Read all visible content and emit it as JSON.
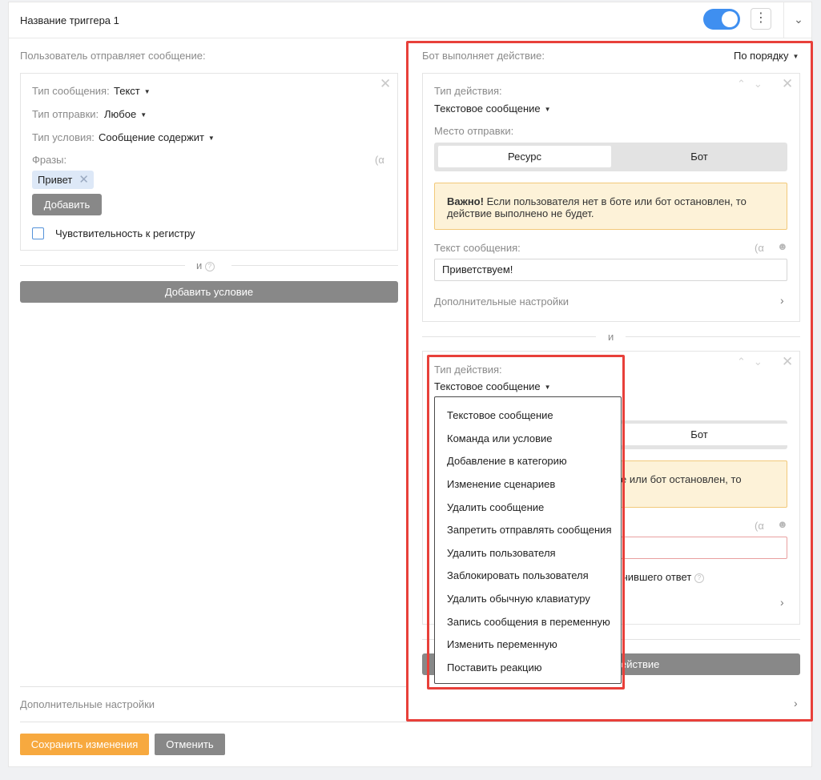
{
  "header": {
    "title": "Название триггера 1",
    "toggle_on": true
  },
  "left": {
    "section_title": "Пользователь отправляет сообщение:",
    "message_type_label": "Тип сообщения:",
    "message_type_value": "Текст",
    "send_type_label": "Тип отправки:",
    "send_type_value": "Любое",
    "condition_type_label": "Тип условия:",
    "condition_type_value": "Сообщение содержит",
    "phrases_label": "Фразы:",
    "phrase_tag": "Привет",
    "add_button": "Добавить",
    "case_sensitive_label": "Чувствительность к регистру",
    "and_label": "и",
    "add_condition_button": "Добавить условие"
  },
  "right": {
    "section_title": "Бот выполняет действие:",
    "order_select": "По порядку",
    "action1": {
      "action_type_label": "Тип действия:",
      "action_type_value": "Текстовое сообщение",
      "send_place_label": "Место отправки:",
      "seg_resource": "Ресурс",
      "seg_bot": "Бот",
      "warning_bold": "Важно!",
      "warning_text": " Если пользователя нет в боте или бот остановлен, то действие выполнено не будет.",
      "message_text_label": "Текст сообщения:",
      "message_text_value": "Приветствуем!",
      "extra_settings": "Дополнительные настройки"
    },
    "and_label": "и",
    "action2": {
      "action_type_label": "Тип действия:",
      "action_type_value": "Текстовое сообщение",
      "seg_bot": "Бот",
      "warning_partial": "е или бот остановлен, то",
      "partial_text": "чившего ответ",
      "add_action_partial": "ействие"
    }
  },
  "dropdown": {
    "items": [
      "Текстовое сообщение",
      "Команда или условие",
      "Добавление в категорию",
      "Изменение сценариев",
      "Удалить сообщение",
      "Запретить отправлять сообщения",
      "Удалить пользователя",
      "Заблокировать пользователя",
      "Удалить обычную клавиатуру",
      "Запись сообщения в переменную",
      "Изменить переменную",
      "Поставить реакцию"
    ]
  },
  "footer": {
    "extra_settings": "Дополнительные настройки",
    "save_button": "Сохранить изменения",
    "cancel_button": "Отменить"
  },
  "colors": {
    "accent": "#3f8ff0",
    "highlight": "#e8403a",
    "warning_bg": "#fdf2d8",
    "save": "#f7a93f"
  }
}
